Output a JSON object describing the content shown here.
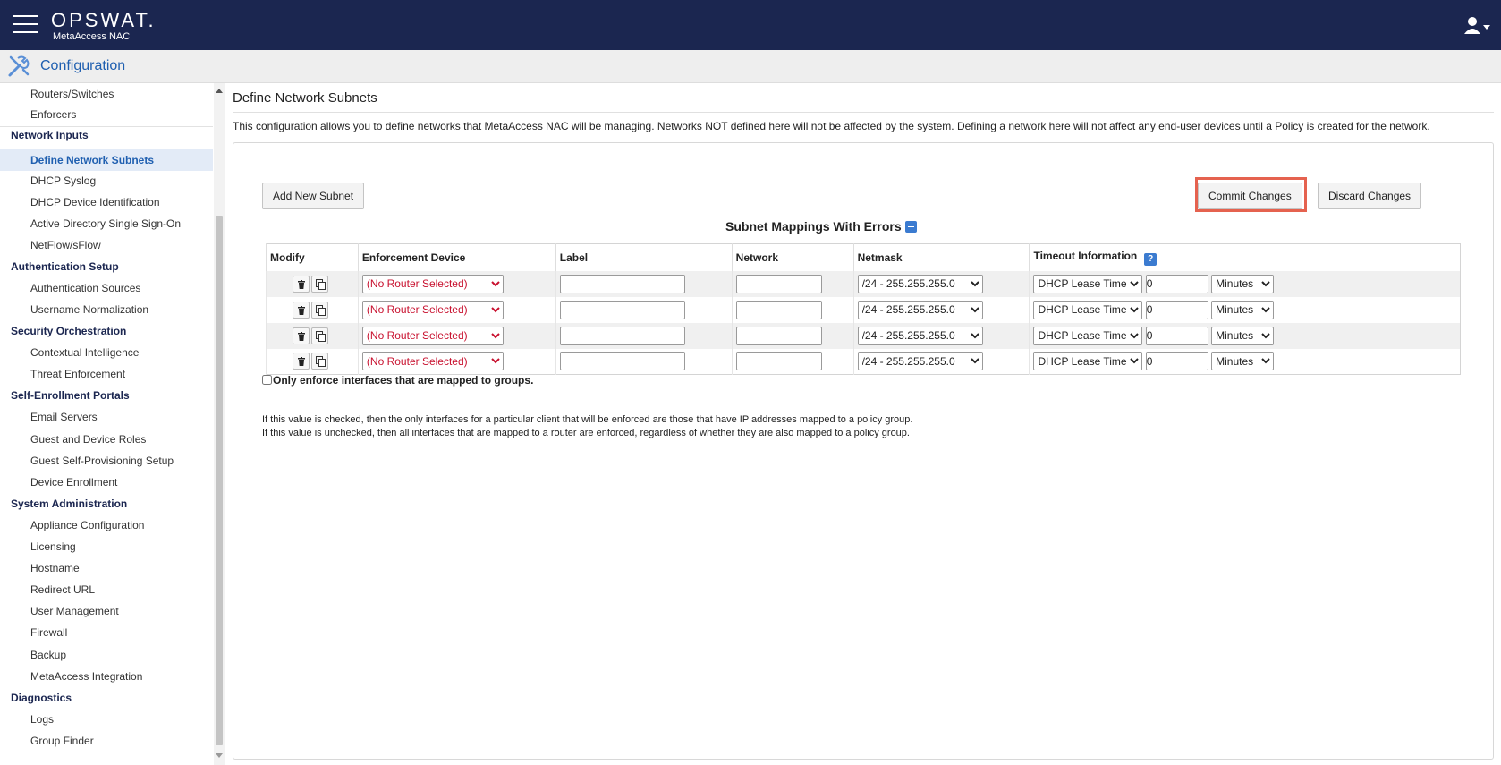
{
  "header": {
    "logo_text": "OPSWAT.",
    "logo_subtitle": "MetaAccess NAC",
    "menu_icon": "hamburger-icon",
    "user_icon": "user-icon"
  },
  "section": {
    "title": "Configuration",
    "icon": "tools-icon"
  },
  "sidebar": {
    "items": [
      {
        "label": "Routers/Switches",
        "level": "sub"
      },
      {
        "label": "Enforcers",
        "level": "sub"
      },
      {
        "label": "Network Inputs",
        "level": "head"
      },
      {
        "label": "Define Network Subnets",
        "level": "sub",
        "active": true
      },
      {
        "label": "DHCP Syslog",
        "level": "sub"
      },
      {
        "label": "DHCP Device Identification",
        "level": "sub"
      },
      {
        "label": "Active Directory Single Sign-On",
        "level": "sub"
      },
      {
        "label": "NetFlow/sFlow",
        "level": "sub"
      },
      {
        "label": "Authentication Setup",
        "level": "head"
      },
      {
        "label": "Authentication Sources",
        "level": "sub"
      },
      {
        "label": "Username Normalization",
        "level": "sub"
      },
      {
        "label": "Security Orchestration",
        "level": "head"
      },
      {
        "label": "Contextual Intelligence",
        "level": "sub"
      },
      {
        "label": "Threat Enforcement",
        "level": "sub"
      },
      {
        "label": "Self-Enrollment Portals",
        "level": "head"
      },
      {
        "label": "Email Servers",
        "level": "sub"
      },
      {
        "label": "Guest and Device Roles",
        "level": "sub"
      },
      {
        "label": "Guest Self-Provisioning Setup",
        "level": "sub"
      },
      {
        "label": "Device Enrollment",
        "level": "sub"
      },
      {
        "label": "System Administration",
        "level": "head"
      },
      {
        "label": "Appliance Configuration",
        "level": "sub"
      },
      {
        "label": "Licensing",
        "level": "sub"
      },
      {
        "label": "Hostname",
        "level": "sub"
      },
      {
        "label": "Redirect URL",
        "level": "sub"
      },
      {
        "label": "User Management",
        "level": "sub"
      },
      {
        "label": "Firewall",
        "level": "sub"
      },
      {
        "label": "Backup",
        "level": "sub"
      },
      {
        "label": "MetaAccess Integration",
        "level": "sub"
      },
      {
        "label": "Diagnostics",
        "level": "head"
      },
      {
        "label": "Logs",
        "level": "sub"
      },
      {
        "label": "Group Finder",
        "level": "sub"
      }
    ]
  },
  "main": {
    "title": "Define Network Subnets",
    "description": "This configuration allows you to define networks that MetaAccess NAC will be managing. Networks NOT defined here will not be affected by the system. Defining a network here will not affect any end-user devices until a Policy is created for the network.",
    "add_button": "Add New Subnet",
    "commit_button": "Commit Changes",
    "discard_button": "Discard Changes",
    "table_title": "Subnet Mappings With Errors",
    "columns": {
      "modify": "Modify",
      "device": "Enforcement Device",
      "label": "Label",
      "network": "Network",
      "netmask": "Netmask",
      "timeout": "Timeout Information"
    },
    "help_glyph": "?",
    "rows": [
      {
        "device": "(No Router Selected)",
        "label": "",
        "network": "",
        "netmask": "/24 - 255.255.255.0",
        "timeout_type": "DHCP Lease Time",
        "timeout_value": "0",
        "timeout_unit": "Minutes"
      },
      {
        "device": "(No Router Selected)",
        "label": "",
        "network": "",
        "netmask": "/24 - 255.255.255.0",
        "timeout_type": "DHCP Lease Time",
        "timeout_value": "0",
        "timeout_unit": "Minutes"
      },
      {
        "device": "(No Router Selected)",
        "label": "",
        "network": "",
        "netmask": "/24 - 255.255.255.0",
        "timeout_type": "DHCP Lease Time",
        "timeout_value": "0",
        "timeout_unit": "Minutes"
      },
      {
        "device": "(No Router Selected)",
        "label": "",
        "network": "",
        "netmask": "/24 - 255.255.255.0",
        "timeout_type": "DHCP Lease Time",
        "timeout_value": "0",
        "timeout_unit": "Minutes"
      }
    ],
    "enforce_checkbox_label": "Only enforce interfaces that are mapped to groups.",
    "enforce_checked": false,
    "explain_checked": "If this value is checked, then the only interfaces for a particular client that will be enforced are those that have IP addresses mapped to a policy group.",
    "explain_unchecked": "If this value is unchecked, then all interfaces that are mapped to a router are enforced, regardless of whether they are also mapped to a policy group."
  },
  "colors": {
    "header_bg": "#1b2650",
    "link": "#1f5fb0",
    "commit_highlight": "#e5624f",
    "router_select_text": "#c8102e"
  }
}
